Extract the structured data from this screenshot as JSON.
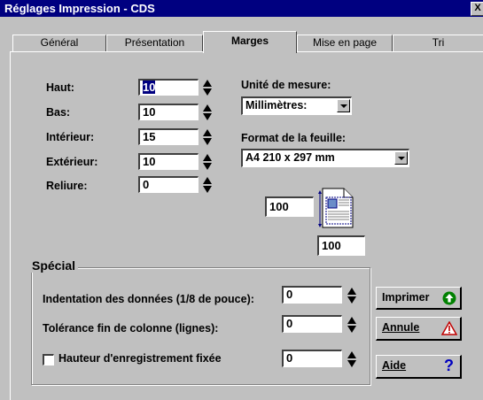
{
  "window": {
    "title": "Réglages Impression - CDS",
    "close_glyph": "X"
  },
  "tabs": [
    "Général",
    "Présentation",
    "Marges",
    "Mise en page",
    "Tri"
  ],
  "active_tab": "Marges",
  "margins": {
    "top_label": "Haut:",
    "top_value": "10",
    "bottom_label": "Bas:",
    "bottom_value": "10",
    "inner_label": "Intérieur:",
    "inner_value": "15",
    "outer_label": "Extérieur:",
    "outer_value": "10",
    "binding_label": "Reliure:",
    "binding_value": "0"
  },
  "unit": {
    "label": "Unité de mesure:",
    "value": "Millimètres:"
  },
  "paper": {
    "label": "Format de la feuille:",
    "value": "A4 210 x 297 mm"
  },
  "preview": {
    "width_value": "100",
    "height_value": "100",
    "icon": "page-layout-icon"
  },
  "special": {
    "caption": "Spécial",
    "indent_label": "Indentation des données (1/8 de pouce):",
    "indent_value": "0",
    "tolerance_label": "Tolérance fin de colonne (lignes):",
    "tolerance_value": "0",
    "fixed_height_label": "Hauteur d'enregistrement fixée",
    "fixed_height_value": "0",
    "fixed_height_checked": false
  },
  "buttons": {
    "print_label": "Imprimer",
    "print_icon": "green-arrow-up-icon",
    "cancel_label": "Annule",
    "cancel_icon": "warning-triangle-icon",
    "help_label": "Aide",
    "help_icon": "question-mark-icon"
  },
  "colors": {
    "titlebar": "#000080",
    "face": "#c0c0c0",
    "print_icon": "#008000",
    "warning_icon": "#c00000",
    "help_icon": "#0000c0"
  }
}
